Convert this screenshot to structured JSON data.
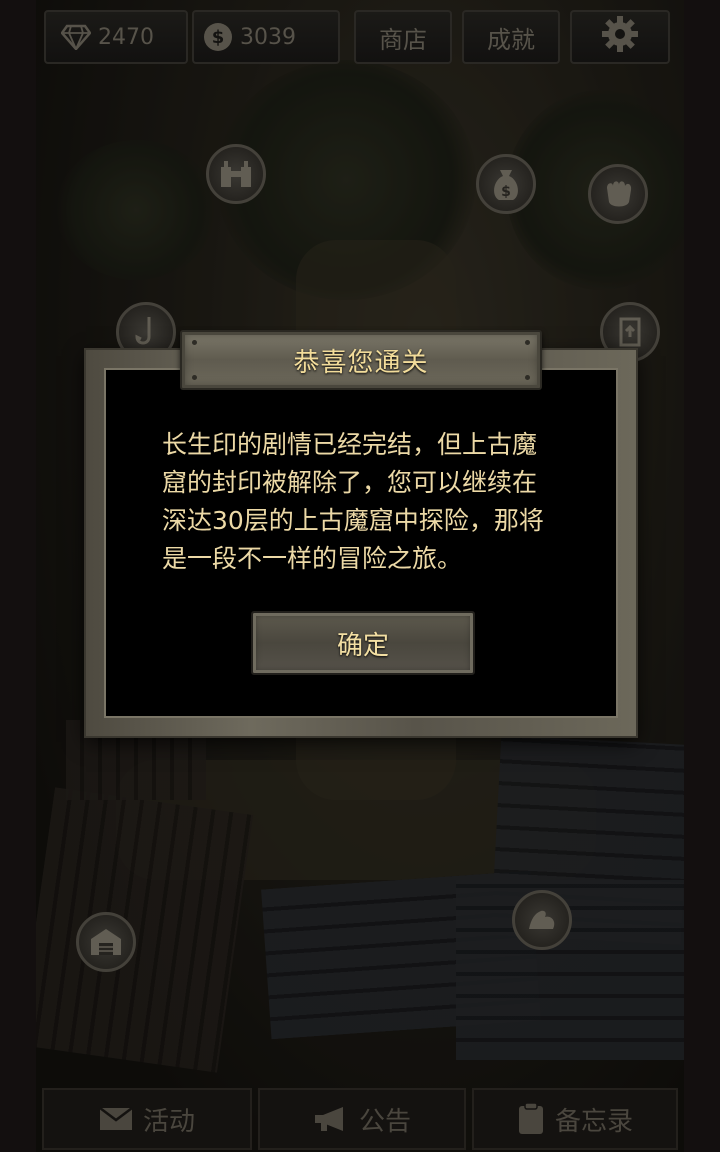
{
  "topbar": {
    "gems": "2470",
    "coins": "3039",
    "shop_label": "商店",
    "achievements_label": "成就"
  },
  "modal": {
    "title": "恭喜您通关",
    "message_lines": [
      "长生印的剧情已经完结，但上古魔",
      "窟的封印被解除了，您可以继续在",
      "深达30层的上古魔窟中探险，那将",
      "是一段不一样的冒险之旅。"
    ],
    "confirm_label": "确定"
  },
  "map": {
    "coin_bag_symbol": "$"
  },
  "bottombar": {
    "events_label": "活动",
    "notice_label": "公告",
    "memo_label": "备忘录"
  }
}
